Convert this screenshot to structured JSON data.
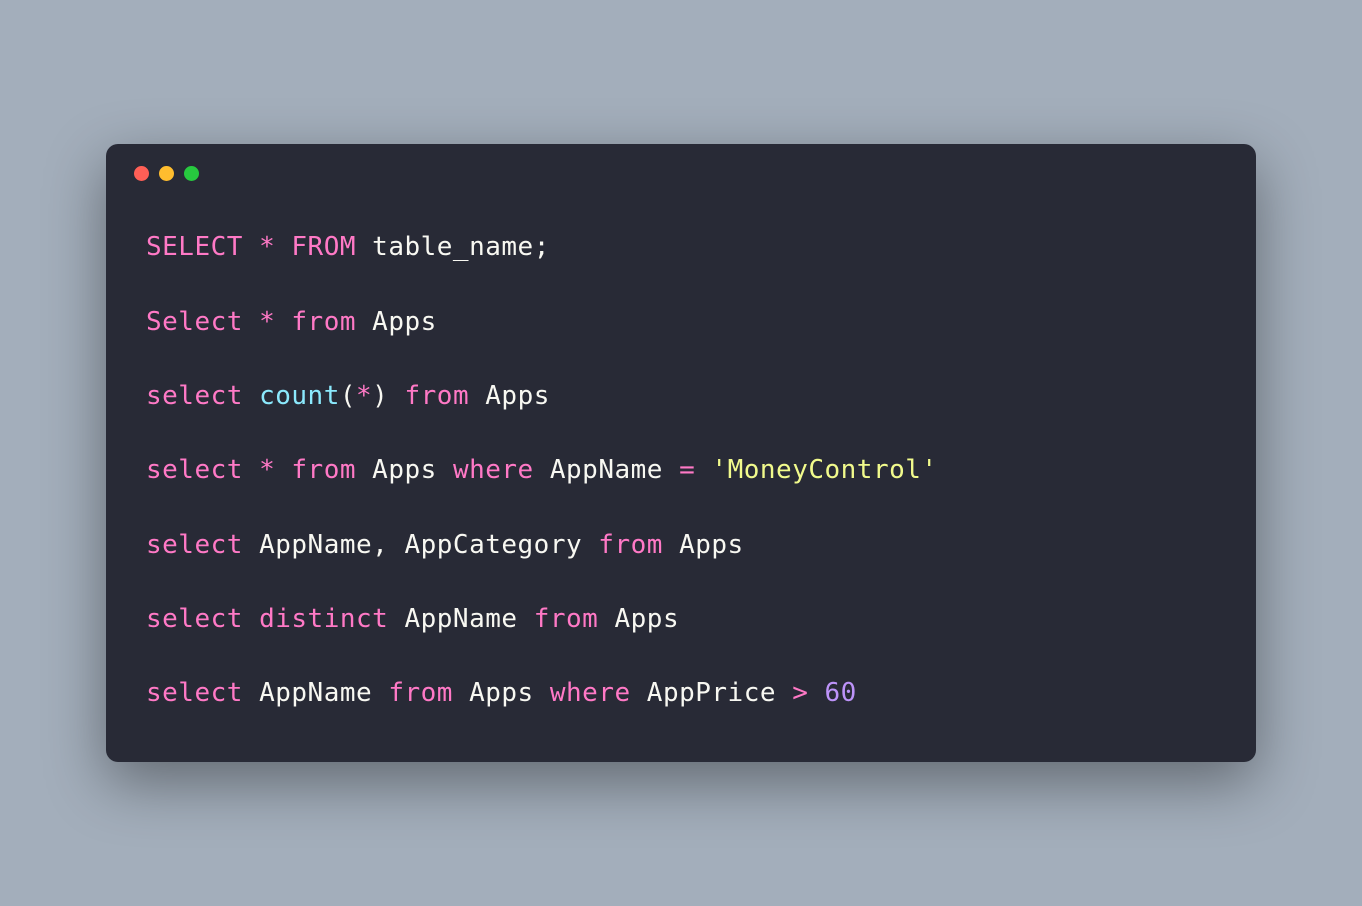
{
  "window": {
    "controls": {
      "close_color": "#ff5f56",
      "minimize_color": "#ffbd2e",
      "maximize_color": "#27c93f"
    }
  },
  "code": {
    "lines": [
      {
        "tokens": [
          {
            "type": "kw",
            "text": "SELECT"
          },
          {
            "type": "txt",
            "text": " "
          },
          {
            "type": "op",
            "text": "*"
          },
          {
            "type": "txt",
            "text": " "
          },
          {
            "type": "kw",
            "text": "FROM"
          },
          {
            "type": "txt",
            "text": " table_name;"
          }
        ]
      },
      {
        "tokens": [
          {
            "type": "kw",
            "text": "Select"
          },
          {
            "type": "txt",
            "text": " "
          },
          {
            "type": "op",
            "text": "*"
          },
          {
            "type": "txt",
            "text": " "
          },
          {
            "type": "kw",
            "text": "from"
          },
          {
            "type": "txt",
            "text": " Apps"
          }
        ]
      },
      {
        "tokens": [
          {
            "type": "kw",
            "text": "select"
          },
          {
            "type": "txt",
            "text": " "
          },
          {
            "type": "fn",
            "text": "count"
          },
          {
            "type": "txt",
            "text": "("
          },
          {
            "type": "op",
            "text": "*"
          },
          {
            "type": "txt",
            "text": ") "
          },
          {
            "type": "kw",
            "text": "from"
          },
          {
            "type": "txt",
            "text": " Apps"
          }
        ]
      },
      {
        "tokens": [
          {
            "type": "kw",
            "text": "select"
          },
          {
            "type": "txt",
            "text": " "
          },
          {
            "type": "op",
            "text": "*"
          },
          {
            "type": "txt",
            "text": " "
          },
          {
            "type": "kw",
            "text": "from"
          },
          {
            "type": "txt",
            "text": " Apps "
          },
          {
            "type": "kw",
            "text": "where"
          },
          {
            "type": "txt",
            "text": " AppName "
          },
          {
            "type": "op",
            "text": "="
          },
          {
            "type": "txt",
            "text": " "
          },
          {
            "type": "str",
            "text": "'MoneyControl'"
          }
        ]
      },
      {
        "tokens": [
          {
            "type": "kw",
            "text": "select"
          },
          {
            "type": "txt",
            "text": " AppName, AppCategory "
          },
          {
            "type": "kw",
            "text": "from"
          },
          {
            "type": "txt",
            "text": " Apps"
          }
        ]
      },
      {
        "tokens": [
          {
            "type": "kw",
            "text": "select"
          },
          {
            "type": "txt",
            "text": " "
          },
          {
            "type": "kw",
            "text": "distinct"
          },
          {
            "type": "txt",
            "text": " AppName "
          },
          {
            "type": "kw",
            "text": "from"
          },
          {
            "type": "txt",
            "text": " Apps"
          }
        ]
      },
      {
        "tokens": [
          {
            "type": "kw",
            "text": "select"
          },
          {
            "type": "txt",
            "text": " AppName "
          },
          {
            "type": "kw",
            "text": "from"
          },
          {
            "type": "txt",
            "text": " Apps "
          },
          {
            "type": "kw",
            "text": "where"
          },
          {
            "type": "txt",
            "text": " AppPrice "
          },
          {
            "type": "op",
            "text": ">"
          },
          {
            "type": "txt",
            "text": " "
          },
          {
            "type": "num",
            "text": "60"
          }
        ]
      }
    ]
  },
  "colors": {
    "background": "#a3aebb",
    "window_bg": "#282a36",
    "keyword": "#ff79c6",
    "function": "#8be9fd",
    "text": "#f8f8f2",
    "operator": "#ff79c6",
    "string": "#f1fa8c",
    "number": "#bd93f9"
  }
}
